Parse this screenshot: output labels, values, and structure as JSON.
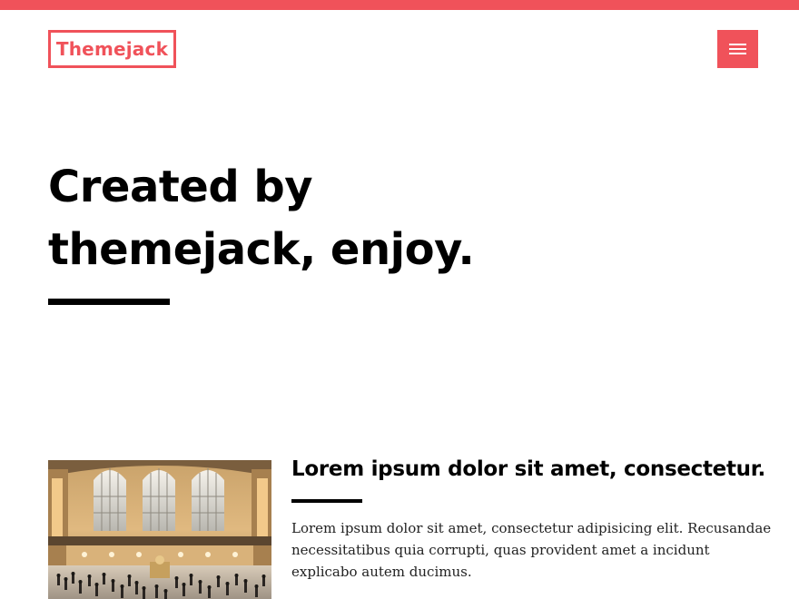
{
  "site": {
    "logo_text": "Themejack",
    "accent_color": "#f0525a",
    "menu_icon": "hamburger-icon"
  },
  "hero": {
    "title_line1": "Created by",
    "title_line2": "themejack, enjoy."
  },
  "post": {
    "image_alt": "train-station-photo",
    "title": "Lorem ipsum dolor sit amet, consectetur.",
    "excerpt": "Lorem ipsum dolor sit amet, consectetur adipisicing elit. Recusandae necessitatibus quia corrupti, quas provident amet a incidunt explicabo autem ducimus."
  }
}
